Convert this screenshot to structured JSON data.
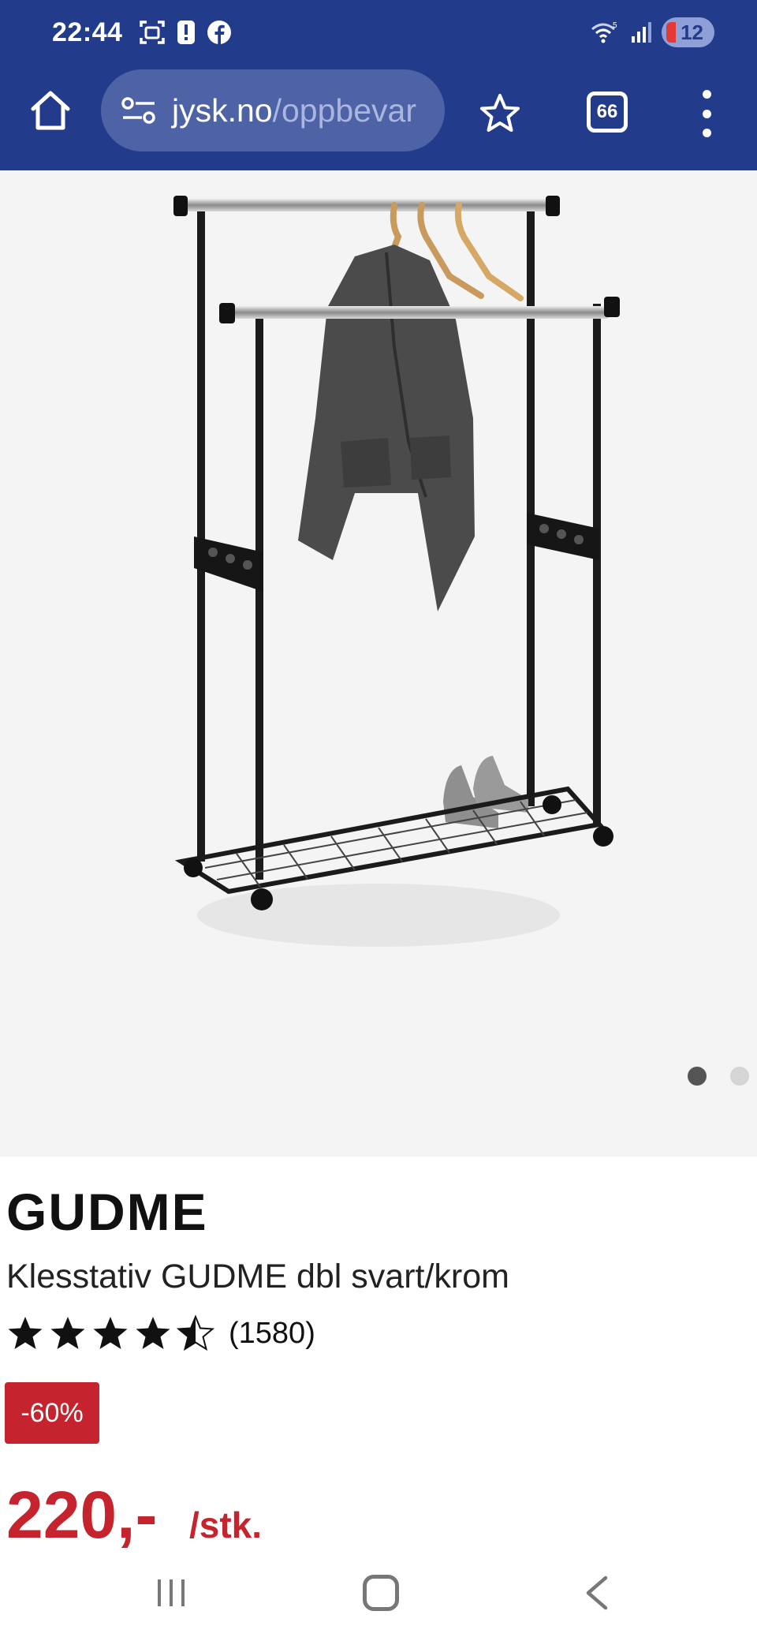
{
  "status_bar": {
    "time": "22:44",
    "battery": "12",
    "icons": [
      "screenshot-icon",
      "alert-icon",
      "facebook-icon",
      "wifi-icon",
      "signal-icon"
    ]
  },
  "browser": {
    "url_host": "jysk.no",
    "url_path": "/oppbevar",
    "tab_count": "66"
  },
  "gallery": {
    "slide_count": 2,
    "active_slide": 1
  },
  "product": {
    "brand": "GUDME",
    "name": "Klesstativ GUDME dbl svart/krom",
    "rating": 4.5,
    "rating_count": "(1580)",
    "discount": "-60%",
    "price": "220,-",
    "unit": "/stk."
  },
  "colors": {
    "toolbar_bg": "#233b8b",
    "accent_red": "#c5242e"
  }
}
